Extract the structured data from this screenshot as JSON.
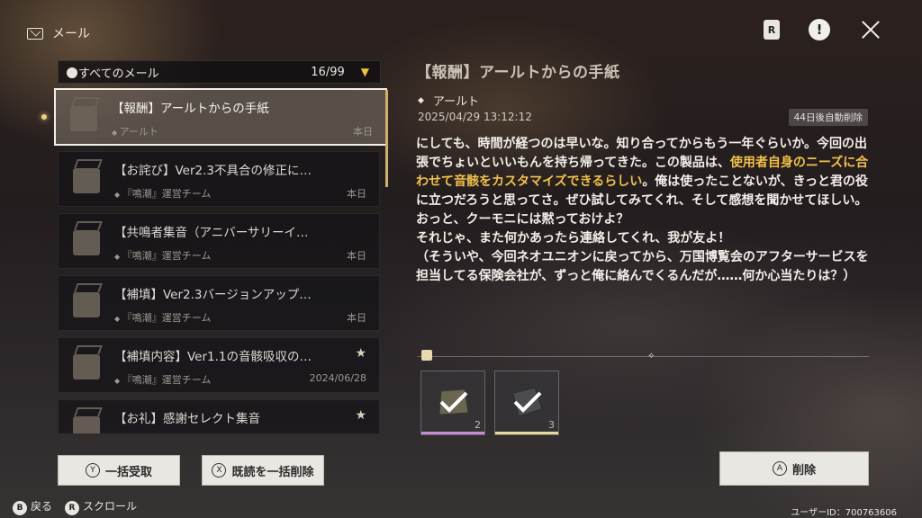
{
  "header": {
    "title": "メール"
  },
  "list": {
    "filter_label": "すべてのメール",
    "count": "16/99",
    "items": [
      {
        "subject": "【報酬】アールトからの手紙",
        "sender": "アールト",
        "date": "本日",
        "starred": false
      },
      {
        "subject": "【お詫び】Ver2.3不具合の修正に…",
        "sender": "『鳴潮』運営チーム",
        "date": "本日",
        "starred": false
      },
      {
        "subject": "【共鳴者集音（アニバーサリーイ…",
        "sender": "『鳴潮』運営チーム",
        "date": "本日",
        "starred": false
      },
      {
        "subject": "【補填】Ver2.3バージョンアップ…",
        "sender": "『鳴潮』運営チーム",
        "date": "本日",
        "starred": false
      },
      {
        "subject": "【補填内容】Ver1.1の音骸吸収の…",
        "sender": "『鳴潮』運営チーム",
        "date": "2024/06/28",
        "starred": true
      },
      {
        "subject": "【お礼】感謝セレクト集音",
        "sender": "",
        "date": "",
        "starred": true
      }
    ]
  },
  "detail": {
    "title": "【報酬】アールトからの手紙",
    "sender": "アールト",
    "time": "2025/04/29 13:12:12",
    "auto_delete": "44日後自動削除",
    "body_pre": "にしても、時間が経つのは早いな。知り合ってからもう一年ぐらいか。今回の出張でちょいといいもんを持ち帰ってきた。この製品は、",
    "body_highlight": "使用者自身のニーズに合わせて音骸をカスタマイズできるらしい",
    "body_post": "。俺は使ったことないが、きっと君の役に立つだろうと思ってさ。ぜひ試してみてくれ、そして感想を聞かせてほしい。おっと、クーモニには黙っておけよ？",
    "body_line2": "それじゃ、また何かあったら連絡してくれ、我が友よ！",
    "body_line3": "（そういや、今回ネオユニオンに戻ってから、万国博覧会のアフターサービスを担当してる保険会社が、ずっと俺に絡んでくるんだが……何か心当たりは？）",
    "attachments": [
      {
        "qty": "2",
        "bar_color": "#c88ad8"
      },
      {
        "qty": "3",
        "bar_color": "#e6d79a"
      }
    ]
  },
  "buttons": {
    "claim_all": "一括受取",
    "claim_all_key": "Y",
    "delete_read": "既読を一括削除",
    "delete_read_key": "X",
    "delete": "削除",
    "delete_key": "A"
  },
  "footer": {
    "back": "戻る",
    "back_key": "B",
    "scroll": "スクロール",
    "scroll_key": "R",
    "user_id": "ユーザーID：700763606"
  }
}
